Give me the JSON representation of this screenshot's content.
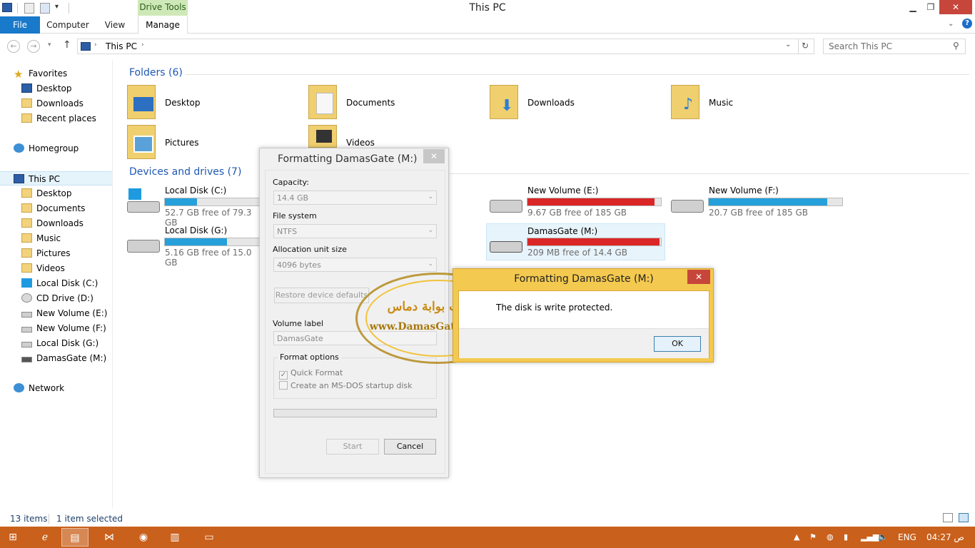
{
  "window": {
    "title": "This PC",
    "contextual_tab": "Drive Tools"
  },
  "ribbon": {
    "file": "File",
    "tabs": [
      "Computer",
      "View"
    ],
    "manage": "Manage"
  },
  "address": {
    "location": "This PC",
    "search_placeholder": "Search This PC"
  },
  "nav": {
    "favorites": "Favorites",
    "fav_items": [
      "Desktop",
      "Downloads",
      "Recent places"
    ],
    "homegroup": "Homegroup",
    "thispc": "This PC",
    "pc_items": [
      "Desktop",
      "Documents",
      "Downloads",
      "Music",
      "Pictures",
      "Videos",
      "Local Disk (C:)",
      "CD Drive (D:)",
      "New Volume (E:)",
      "New Volume (F:)",
      "Local Disk (G:)",
      "DamasGate (M:)"
    ],
    "network": "Network"
  },
  "folders": {
    "heading": "Folders (6)",
    "items": [
      "Desktop",
      "Documents",
      "Downloads",
      "Music",
      "Pictures",
      "Videos"
    ]
  },
  "drives": {
    "heading": "Devices and drives (7)",
    "items": [
      {
        "name": "Local Disk (C:)",
        "free": "52.7 GB free of 79.3 GB",
        "used_fraction": 0.34,
        "color": "#26a0da"
      },
      {
        "name": "New Volume (E:)",
        "free": "9.67 GB free of 185 GB",
        "used_fraction": 0.95,
        "color": "#da2626"
      },
      {
        "name": "New Volume (F:)",
        "free": "20.7 GB free of 185 GB",
        "used_fraction": 0.89,
        "color": "#26a0da"
      },
      {
        "name": "Local Disk (G:)",
        "free": "5.16 GB free of 15.0 GB",
        "used_fraction": 0.66,
        "color": "#26a0da"
      },
      {
        "name": "DamasGate (M:)",
        "free": "209 MB free of 14.4 GB",
        "used_fraction": 0.99,
        "color": "#da2626"
      }
    ]
  },
  "format_dialog": {
    "title": "Formatting DamasGate (M:)",
    "capacity_label": "Capacity:",
    "capacity_value": "14.4 GB",
    "fs_label": "File system",
    "fs_value": "NTFS",
    "alloc_label": "Allocation unit size",
    "alloc_value": "4096 bytes",
    "restore_button": "Restore device defaults",
    "volume_label": "Volume label",
    "volume_value": "DamasGate",
    "options_label": "Format options",
    "quick_format": "Quick Format",
    "msdos": "Create an MS-DOS startup disk",
    "start": "Start",
    "cancel": "Cancel"
  },
  "error_dialog": {
    "title": "Formatting DamasGate (M:)",
    "message": "The disk is write protected.",
    "ok": "OK"
  },
  "watermark": {
    "arabic": "منتديات بوابة دماس",
    "url": "www.DamasGate.com/vb"
  },
  "status": {
    "items": "13 items",
    "selected": "1 item selected"
  },
  "taskbar": {
    "lang": "ENG",
    "time": "04:27 ص"
  },
  "colors": {
    "file_tab": "#1979ca",
    "taskbar": "#c9601b",
    "error_frame": "#f4c94f",
    "close_red": "#c7463b"
  }
}
